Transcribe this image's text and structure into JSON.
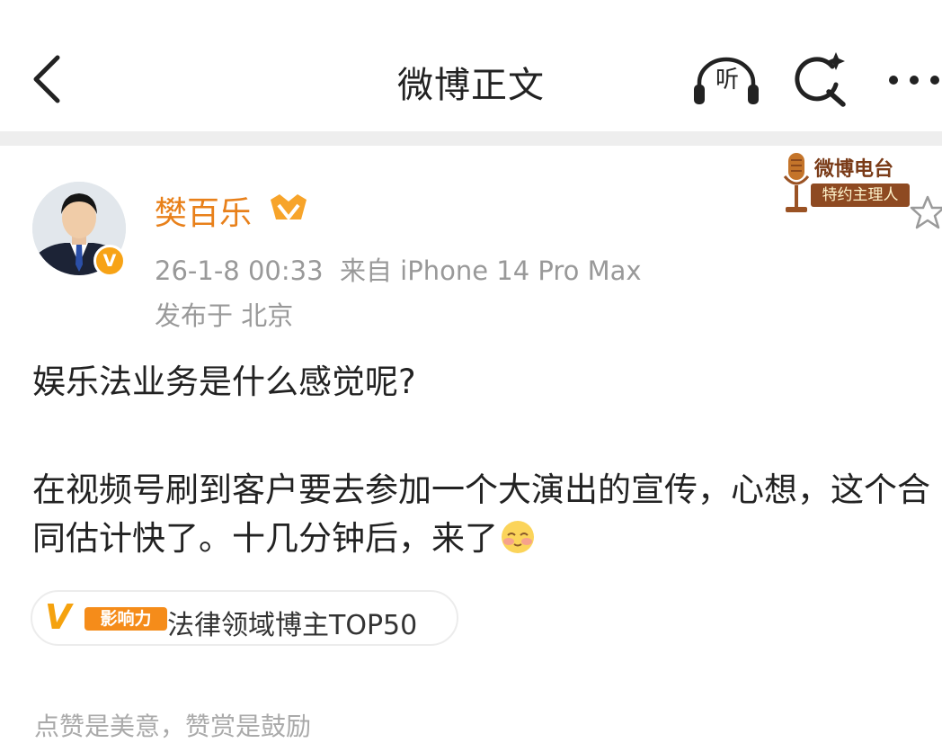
{
  "header": {
    "title": "微博正文",
    "listen_label": "听"
  },
  "post": {
    "author": {
      "name": "樊百乐",
      "verified_badge": "V"
    },
    "meta": {
      "time": "26-1-8 00:33",
      "source": "来自 iPhone 14 Pro Max",
      "location": "发布于 北京"
    },
    "radio_badge": {
      "title": "微博电台",
      "subtitle": "特约主理人"
    },
    "title_line": "娱乐法业务是什么感觉呢?",
    "body": "在视频号刷到客户要去参加一个大演出的宣传，心想，这个合同估计快了。十几分钟后，来了",
    "influence": {
      "mark": "V",
      "label": "影响力",
      "text": "法律领域博主TOP50"
    },
    "footer_note": "点赞是美意，赞赏是鼓励"
  },
  "colors": {
    "accent": "#e8801a",
    "muted_text": "#999999",
    "badge_orange": "#f7a316"
  },
  "icons": {
    "back": "chevron-left-icon",
    "listen": "headphones-icon",
    "search": "search-sparkle-icon",
    "more": "more-dots-icon",
    "member": "member-crown-icon",
    "radio": "microphone-icon",
    "star": "star-outline-icon",
    "emoji": "blushing-face-icon"
  }
}
